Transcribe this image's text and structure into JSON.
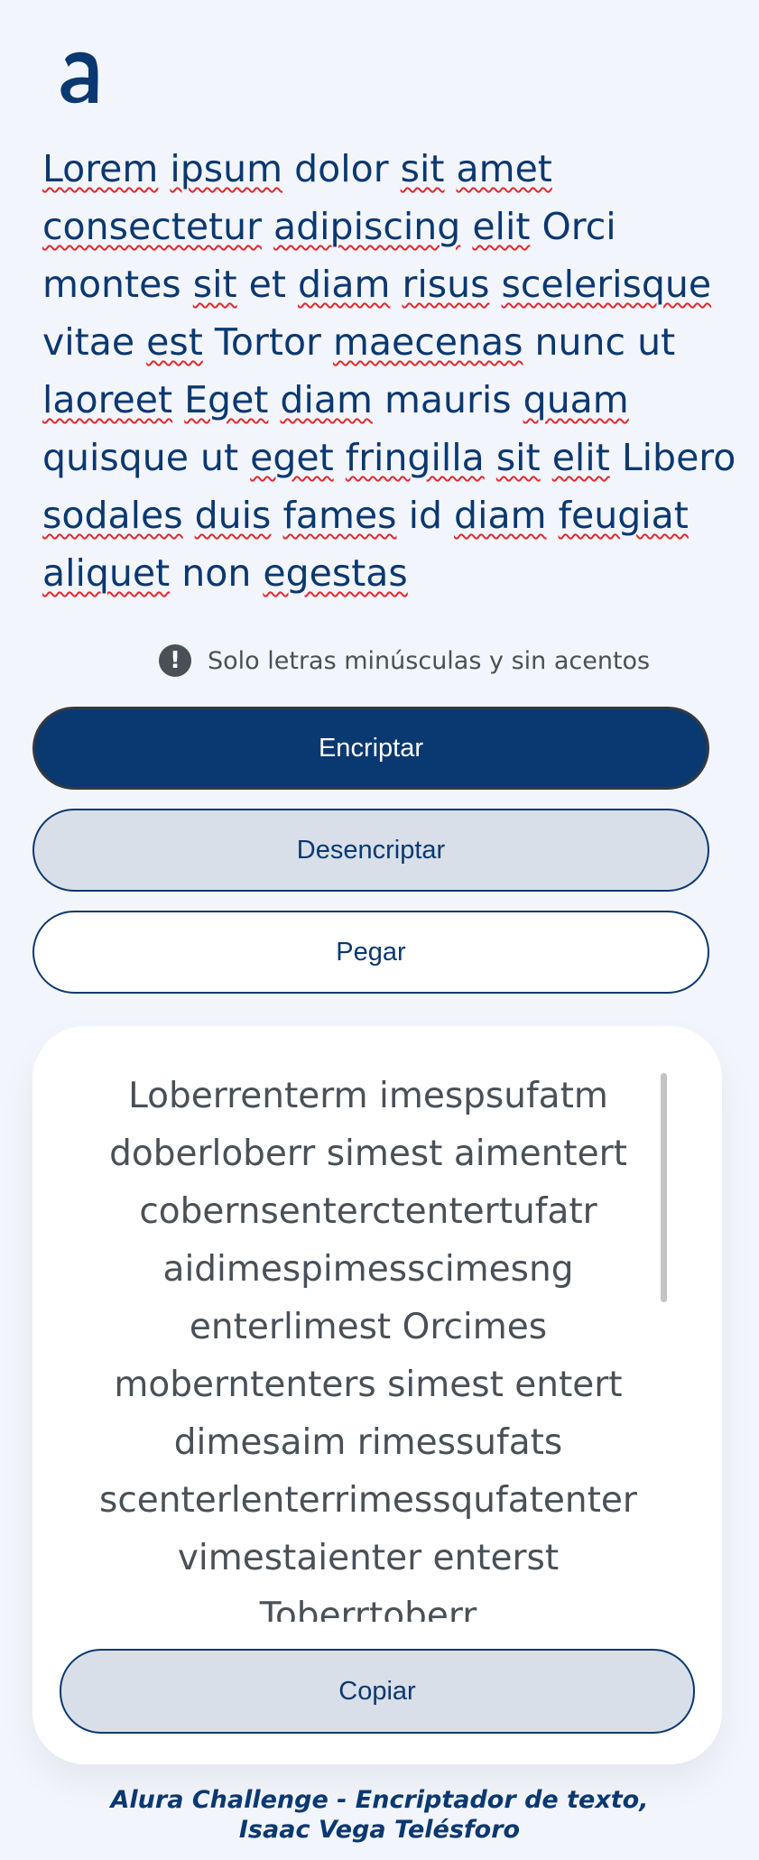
{
  "logo": {
    "icon": "alura-logo",
    "color": "#0a3871"
  },
  "input": {
    "words": [
      {
        "t": "Lorem",
        "sp": true
      },
      {
        "t": "ipsum",
        "sp": true
      },
      {
        "t": "dolor",
        "sp": false
      },
      {
        "t": "sit",
        "sp": true
      },
      {
        "t": "amet",
        "sp": true
      },
      {
        "t": "consectetur",
        "sp": true
      },
      {
        "t": "adipiscing",
        "sp": true
      },
      {
        "t": "elit",
        "sp": true
      },
      {
        "t": "Orci",
        "sp": false
      },
      {
        "t": "montes",
        "sp": false
      },
      {
        "t": "sit",
        "sp": true
      },
      {
        "t": "et",
        "sp": false
      },
      {
        "t": "diam",
        "sp": true
      },
      {
        "t": "risus",
        "sp": true
      },
      {
        "t": "scelerisque",
        "sp": true
      },
      {
        "t": "vitae",
        "sp": false
      },
      {
        "t": "est",
        "sp": true
      },
      {
        "t": "Tortor",
        "sp": false
      },
      {
        "t": "maecenas",
        "sp": true
      },
      {
        "t": "nunc",
        "sp": false
      },
      {
        "t": "ut",
        "sp": false
      },
      {
        "t": "laoreet",
        "sp": true
      },
      {
        "t": "Eget",
        "sp": true
      },
      {
        "t": "diam",
        "sp": true
      },
      {
        "t": "mauris",
        "sp": false
      },
      {
        "t": "quam",
        "sp": true
      },
      {
        "t": "quisque",
        "sp": false
      },
      {
        "t": "ut",
        "sp": false
      },
      {
        "t": "eget",
        "sp": true
      },
      {
        "t": "fringilla",
        "sp": true
      },
      {
        "t": "sit",
        "sp": true
      },
      {
        "t": "elit",
        "sp": true
      },
      {
        "t": "Libero",
        "sp": false
      },
      {
        "t": "sodales",
        "sp": true
      },
      {
        "t": "duis",
        "sp": true
      },
      {
        "t": "fames",
        "sp": true
      },
      {
        "t": "id",
        "sp": false
      },
      {
        "t": "diam",
        "sp": true
      },
      {
        "t": "feugiat",
        "sp": true
      },
      {
        "t": "aliquet",
        "sp": true
      },
      {
        "t": "non",
        "sp": false
      },
      {
        "t": "egestas",
        "sp": true
      }
    ]
  },
  "hint": {
    "icon": "exclamation-circle-icon",
    "text": "Solo letras minúsculas y sin acentos"
  },
  "buttons": {
    "encrypt": "Encriptar",
    "decrypt": "Desencriptar",
    "paste": "Pegar",
    "copy": "Copiar"
  },
  "output": {
    "text": "Loberrenterm imespsufatm doberloberr simest aimentert cobernsenterctentertufatr aidimespimesscimesng enterlimest Orcimes moberntenters simest entert dimesaim rimessufats scenterlenterrimessqufatenter vimestaienter enterst Toberrtoberr"
  },
  "footer": {
    "line1": "Alura Challenge - Encriptador de texto,",
    "line2": "Isaac Vega Telésforo"
  },
  "colors": {
    "primary": "#0a3871",
    "background": "#f3f5fc",
    "spellcheck": "#e0292d"
  }
}
